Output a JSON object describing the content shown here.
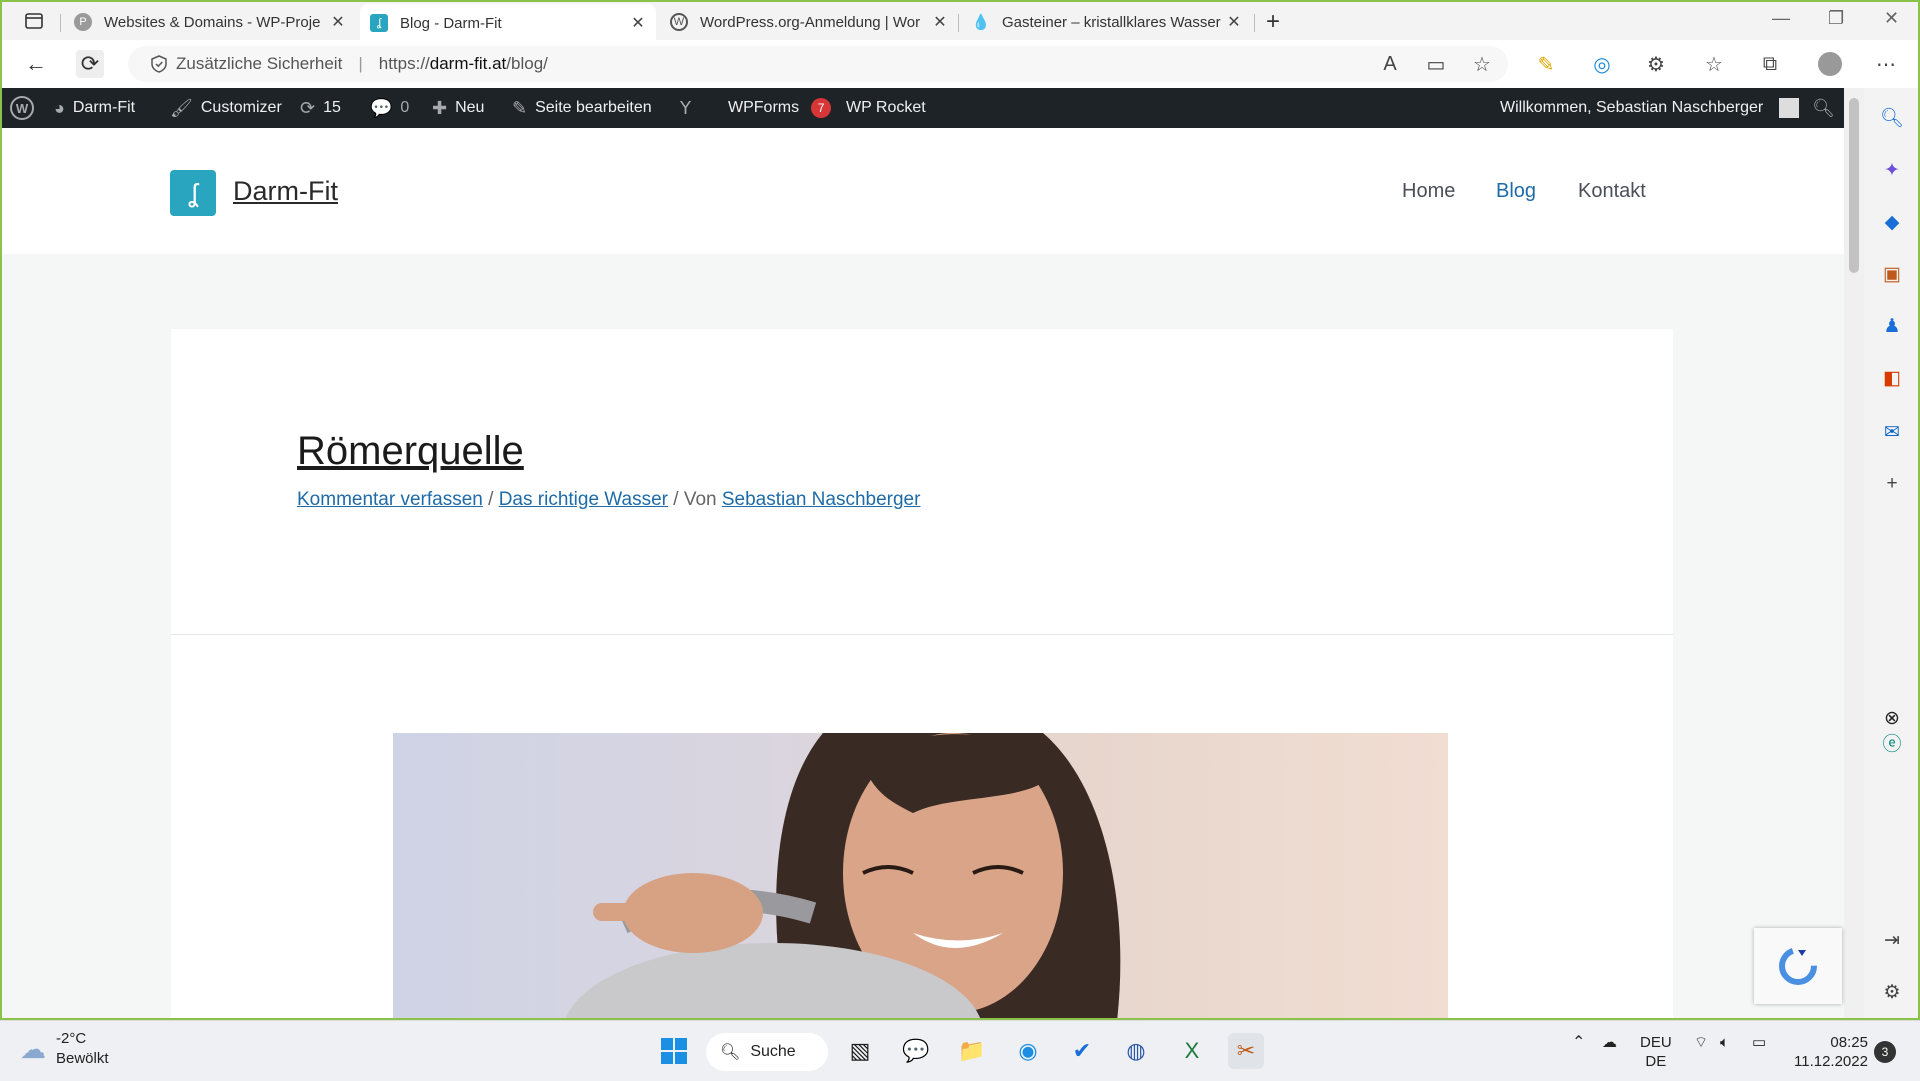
{
  "browser": {
    "tabs": [
      {
        "title": "Websites & Domains - WP-Proje",
        "favicon": "p-circle-icon"
      },
      {
        "title": "Blog - Darm-Fit",
        "favicon": "darmfit-icon",
        "active": true
      },
      {
        "title": "WordPress.org-Anmeldung | Wor",
        "favicon": "wordpress-icon"
      },
      {
        "title": "Gasteiner – kristallklares Wasser",
        "favicon": "water-drop-icon"
      }
    ],
    "address": {
      "security_label": "Zusätzliche Sicherheit",
      "url_prefix": "https://",
      "url_host": "darm-fit.at",
      "url_path": "/blog/"
    }
  },
  "adminbar": {
    "site": "Darm-Fit",
    "customizer": "Customizer",
    "updates": "15",
    "comments": "0",
    "new": "Neu",
    "edit": "Seite bearbeiten",
    "wpforms": "WPForms",
    "wpforms_badge": "7",
    "wprocket": "WP Rocket",
    "welcome": "Willkommen, Sebastian Naschberger"
  },
  "site": {
    "title": "Darm-Fit",
    "menu": [
      "Home",
      "Blog",
      "Kontakt"
    ],
    "active_menu": "Blog"
  },
  "post": {
    "title": "Römerquelle",
    "comment_link": "Kommentar verfassen",
    "sep1": " / ",
    "category": "Das richtige Wasser",
    "sep2": " / Von ",
    "author": "Sebastian Naschberger"
  },
  "taskbar": {
    "weather_temp": "-2°C",
    "weather_desc": "Bewölkt",
    "search": "Suche",
    "lang_top": "DEU",
    "lang_bottom": "DE",
    "time": "08:25",
    "date": "11.12.2022",
    "notifications": "3"
  },
  "colors": {
    "accent_link": "#1e6ba8",
    "adminbar_bg": "#1d2327",
    "badge": "#d63638",
    "logo": "#2aa5c0",
    "window_border": "#8bc34a"
  }
}
